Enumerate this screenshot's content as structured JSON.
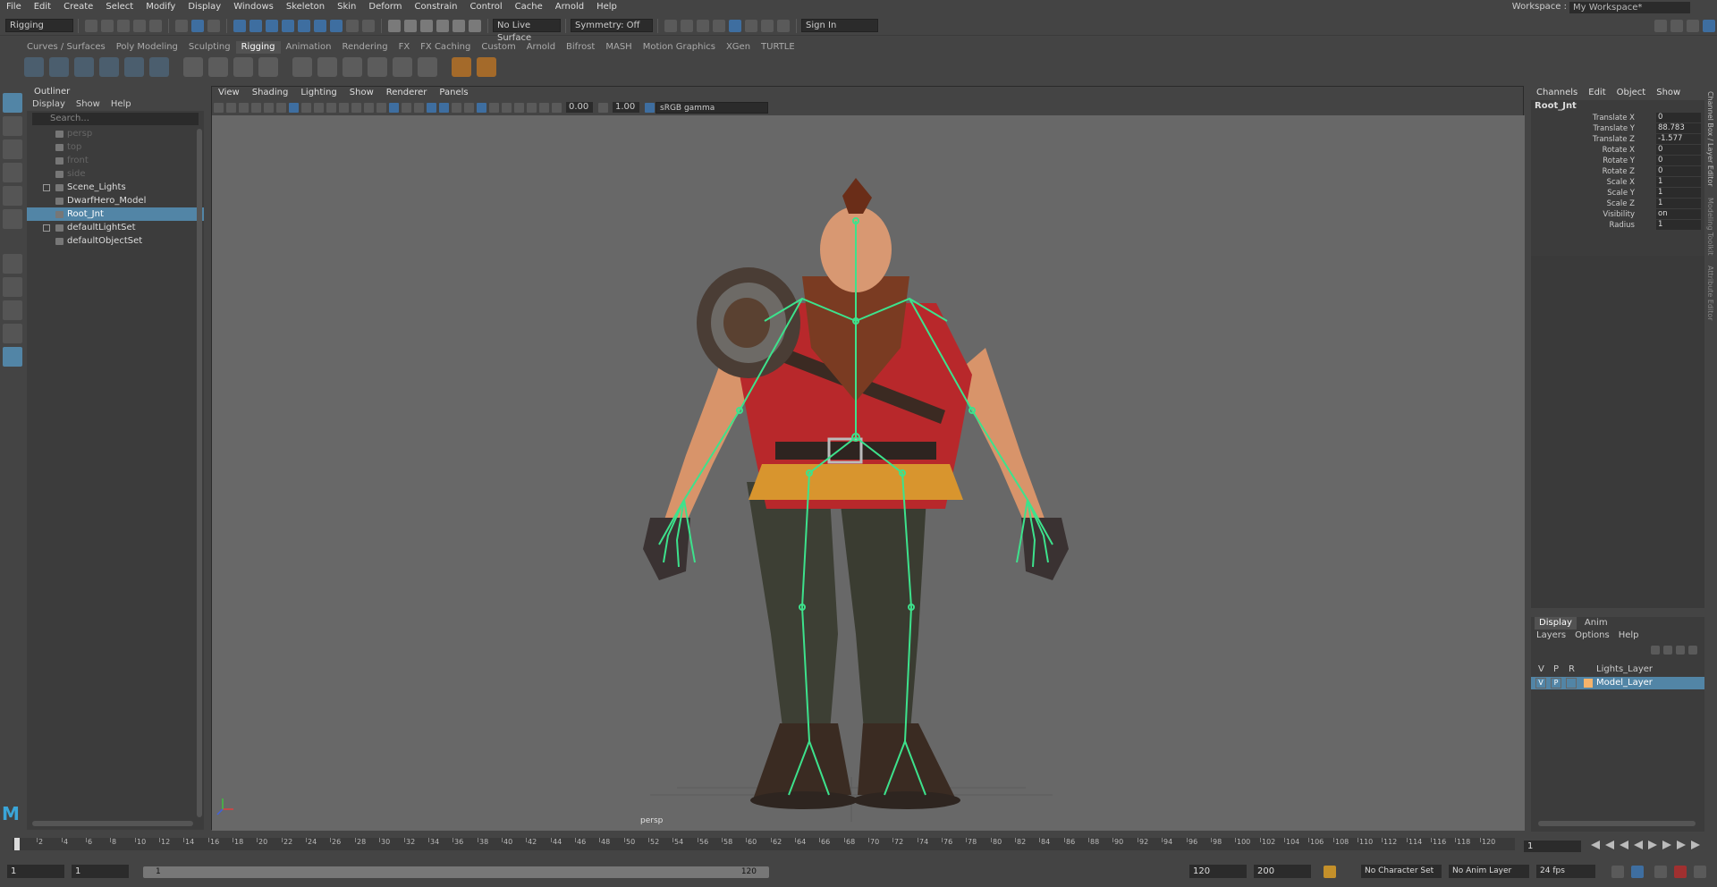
{
  "menubar": {
    "items": [
      "File",
      "Edit",
      "Create",
      "Select",
      "Modify",
      "Display",
      "Windows",
      "Skeleton",
      "Skin",
      "Deform",
      "Constrain",
      "Control",
      "Cache",
      "Arnold",
      "Help"
    ],
    "workspace_label": "Workspace :",
    "workspace_value": "My Workspace*"
  },
  "statusline": {
    "mode": "Rigging",
    "live_surface": "No Live Surface",
    "symmetry": "Symmetry: Off",
    "sign_in": "Sign In"
  },
  "shelf": {
    "tabs": [
      "Curves / Surfaces",
      "Poly Modeling",
      "Sculpting",
      "Rigging",
      "Animation",
      "Rendering",
      "FX",
      "FX Caching",
      "Custom",
      "Arnold",
      "Bifrost",
      "MASH",
      "Motion Graphics",
      "XGen",
      "TURTLE"
    ],
    "active_tab": "Rigging"
  },
  "outliner": {
    "title": "Outliner",
    "menu": [
      "Display",
      "Show",
      "Help"
    ],
    "search_placeholder": "Search...",
    "items": [
      {
        "label": "persp",
        "dim": true
      },
      {
        "label": "top",
        "dim": true
      },
      {
        "label": "front",
        "dim": true
      },
      {
        "label": "side",
        "dim": true
      },
      {
        "label": "Scene_Lights",
        "dim": false
      },
      {
        "label": "DwarfHero_Model",
        "dim": false
      },
      {
        "label": "Root_Jnt",
        "dim": false,
        "selected": true
      },
      {
        "label": "defaultLightSet",
        "dim": false
      },
      {
        "label": "defaultObjectSet",
        "dim": false
      }
    ]
  },
  "viewport": {
    "menu": [
      "View",
      "Shading",
      "Lighting",
      "Show",
      "Renderer",
      "Panels"
    ],
    "field_a": "0.00",
    "field_b": "1.00",
    "color_space": "sRGB gamma",
    "camera": "persp"
  },
  "channelbox": {
    "menu": [
      "Channels",
      "Edit",
      "Object",
      "Show"
    ],
    "object": "Root_Jnt",
    "channels": [
      {
        "name": "Translate X",
        "value": "0"
      },
      {
        "name": "Translate Y",
        "value": "88.783"
      },
      {
        "name": "Translate Z",
        "value": "-1.577"
      },
      {
        "name": "Rotate X",
        "value": "0"
      },
      {
        "name": "Rotate Y",
        "value": "0"
      },
      {
        "name": "Rotate Z",
        "value": "0"
      },
      {
        "name": "Scale X",
        "value": "1"
      },
      {
        "name": "Scale Y",
        "value": "1"
      },
      {
        "name": "Scale Z",
        "value": "1"
      },
      {
        "name": "Visibility",
        "value": "on"
      },
      {
        "name": "Radius",
        "value": "1"
      }
    ],
    "side_tabs": [
      "Channel Box / Layer Editor",
      "Modeling Toolkit",
      "Attribute Editor"
    ]
  },
  "layers": {
    "tabs": [
      "Display",
      "Anim"
    ],
    "menu": [
      "Layers",
      "Options",
      "Help"
    ],
    "header": [
      "V",
      "P",
      "R"
    ],
    "rows": [
      {
        "name": "Lights_Layer",
        "selected": false
      },
      {
        "name": "Model_Layer",
        "selected": true,
        "v": "V",
        "p": "P"
      }
    ],
    "swatch_color": "#f5b36b"
  },
  "timeline": {
    "ticks": [
      "2",
      "4",
      "6",
      "8",
      "10",
      "12",
      "14",
      "16",
      "18",
      "20",
      "22",
      "24",
      "26",
      "28",
      "30",
      "32",
      "34",
      "36",
      "38",
      "40",
      "42",
      "44",
      "46",
      "48",
      "50",
      "52",
      "54",
      "56",
      "58",
      "60",
      "62",
      "64",
      "66",
      "68",
      "70",
      "72",
      "74",
      "76",
      "78",
      "80",
      "82",
      "84",
      "86",
      "88",
      "90",
      "92",
      "94",
      "96",
      "98",
      "100",
      "102",
      "104",
      "106",
      "108",
      "110",
      "112",
      "114",
      "116",
      "118",
      "120"
    ],
    "current_frame": "1"
  },
  "range": {
    "start": "1",
    "inner_start": "1",
    "slider_start": "1",
    "slider_end": "120",
    "end": "120",
    "outer_end": "200",
    "character_set": "No Character Set",
    "anim_layer": "No Anim Layer",
    "fps": "24 fps"
  },
  "colors": {
    "selection": "#5285a6",
    "skeleton": "#3de28c",
    "logo": "#3aa5d8"
  }
}
